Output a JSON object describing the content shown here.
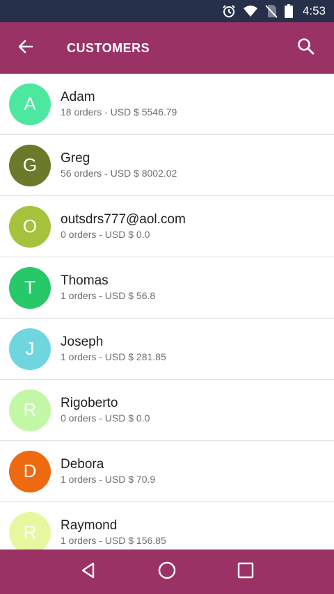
{
  "status_bar": {
    "time": "4:53",
    "icons": [
      "alarm-icon",
      "wifi-icon",
      "no-sim-icon",
      "battery-icon"
    ]
  },
  "app_bar": {
    "title": "CUSTOMERS",
    "back_icon": "arrow-left-icon",
    "search_icon": "search-icon",
    "color": "#9b3266"
  },
  "customers": [
    {
      "initial": "A",
      "name": "Adam",
      "summary": "18 orders - USD $ 5546.79",
      "color": "#4de8a0"
    },
    {
      "initial": "G",
      "name": "Greg",
      "summary": "56 orders - USD $ 8002.02",
      "color": "#6b7a2a"
    },
    {
      "initial": "O",
      "name": "outsdrs777@aol.com",
      "summary": "0 orders - USD $ 0.0",
      "color": "#a6c23d"
    },
    {
      "initial": "T",
      "name": "Thomas",
      "summary": "1 orders - USD $ 56.8",
      "color": "#27c86a"
    },
    {
      "initial": "J",
      "name": "Joseph",
      "summary": "1 orders - USD $ 281.85",
      "color": "#6fd6e0"
    },
    {
      "initial": "R",
      "name": "Rigoberto",
      "summary": "0 orders - USD $ 0.0",
      "color": "#c2f7a6"
    },
    {
      "initial": "D",
      "name": "Debora",
      "summary": "1 orders - USD $ 70.9",
      "color": "#ee6a10"
    },
    {
      "initial": "R",
      "name": "Raymond",
      "summary": "1 orders - USD $ 156.85",
      "color": "#e6f7a0"
    }
  ],
  "nav_bar": {
    "icons": [
      "back-triangle-icon",
      "home-circle-icon",
      "recents-square-icon"
    ]
  }
}
